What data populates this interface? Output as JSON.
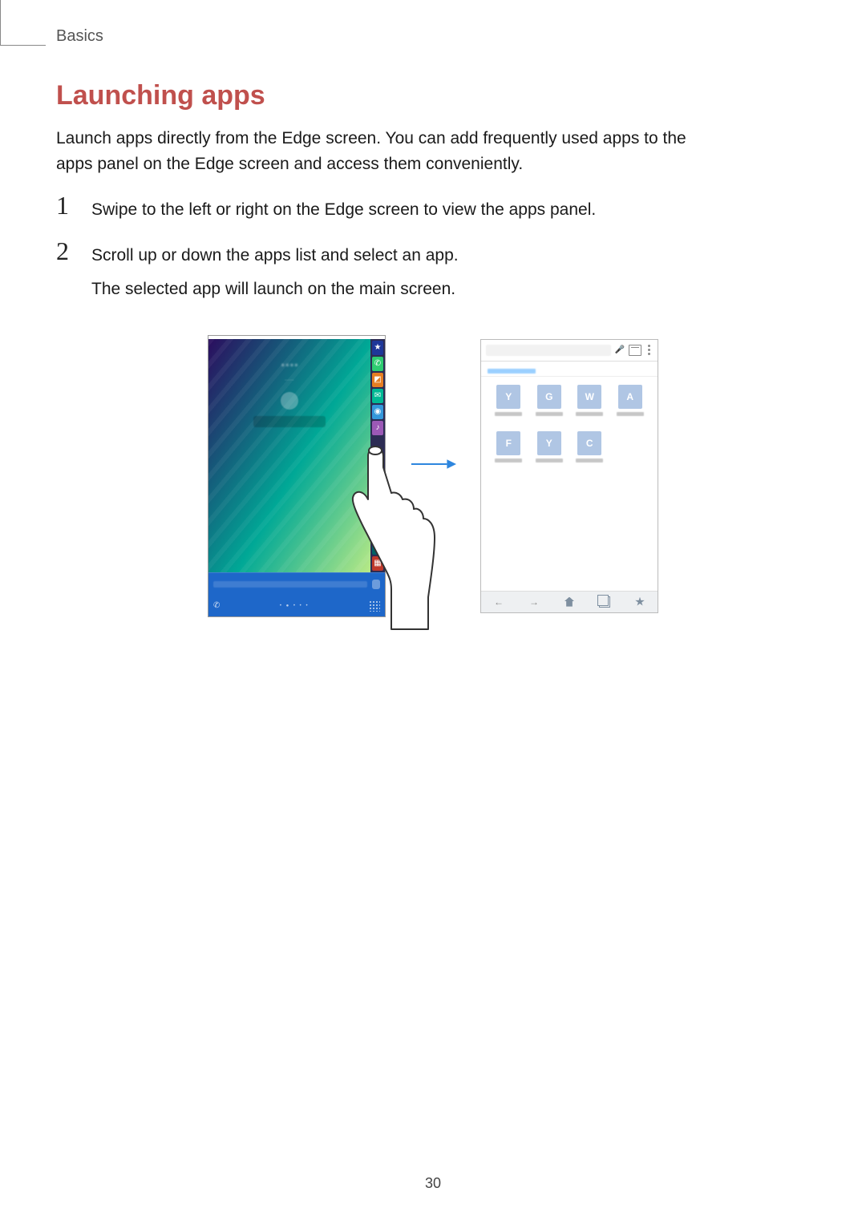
{
  "breadcrumb": "Basics",
  "section": {
    "title": "Launching apps"
  },
  "intro": "Launch apps directly from the Edge screen. You can add frequently used apps to the apps panel on the Edge screen and access them conveniently.",
  "steps": {
    "one": {
      "num": "1",
      "text": "Swipe to the left or right on the Edge screen to view the apps panel."
    },
    "two": {
      "num": "2",
      "text": "Scroll up or down the apps list and select an app.",
      "extra": "The selected app will launch on the main screen."
    }
  },
  "page_number": "30"
}
